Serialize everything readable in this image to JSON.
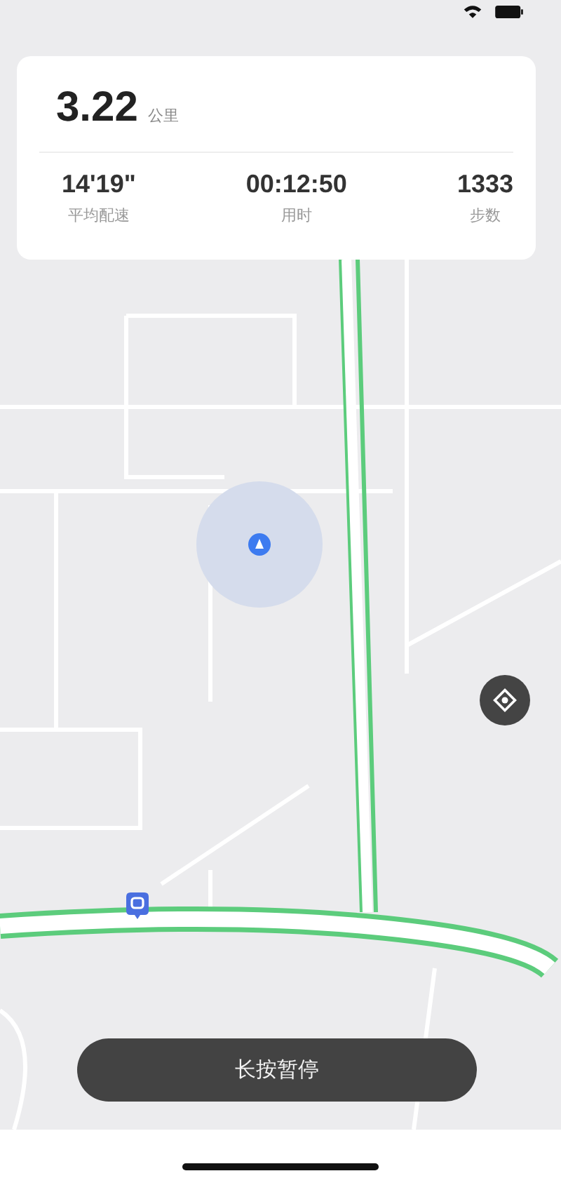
{
  "summary": {
    "distance": "3.22",
    "distance_unit": "公里",
    "stats": [
      {
        "value": "14'19\"",
        "label": "平均配速"
      },
      {
        "value": "00:12:50",
        "label": "用时"
      },
      {
        "value": "1333",
        "label": "步数"
      }
    ]
  },
  "pause_button": {
    "label": "长按暂停"
  }
}
